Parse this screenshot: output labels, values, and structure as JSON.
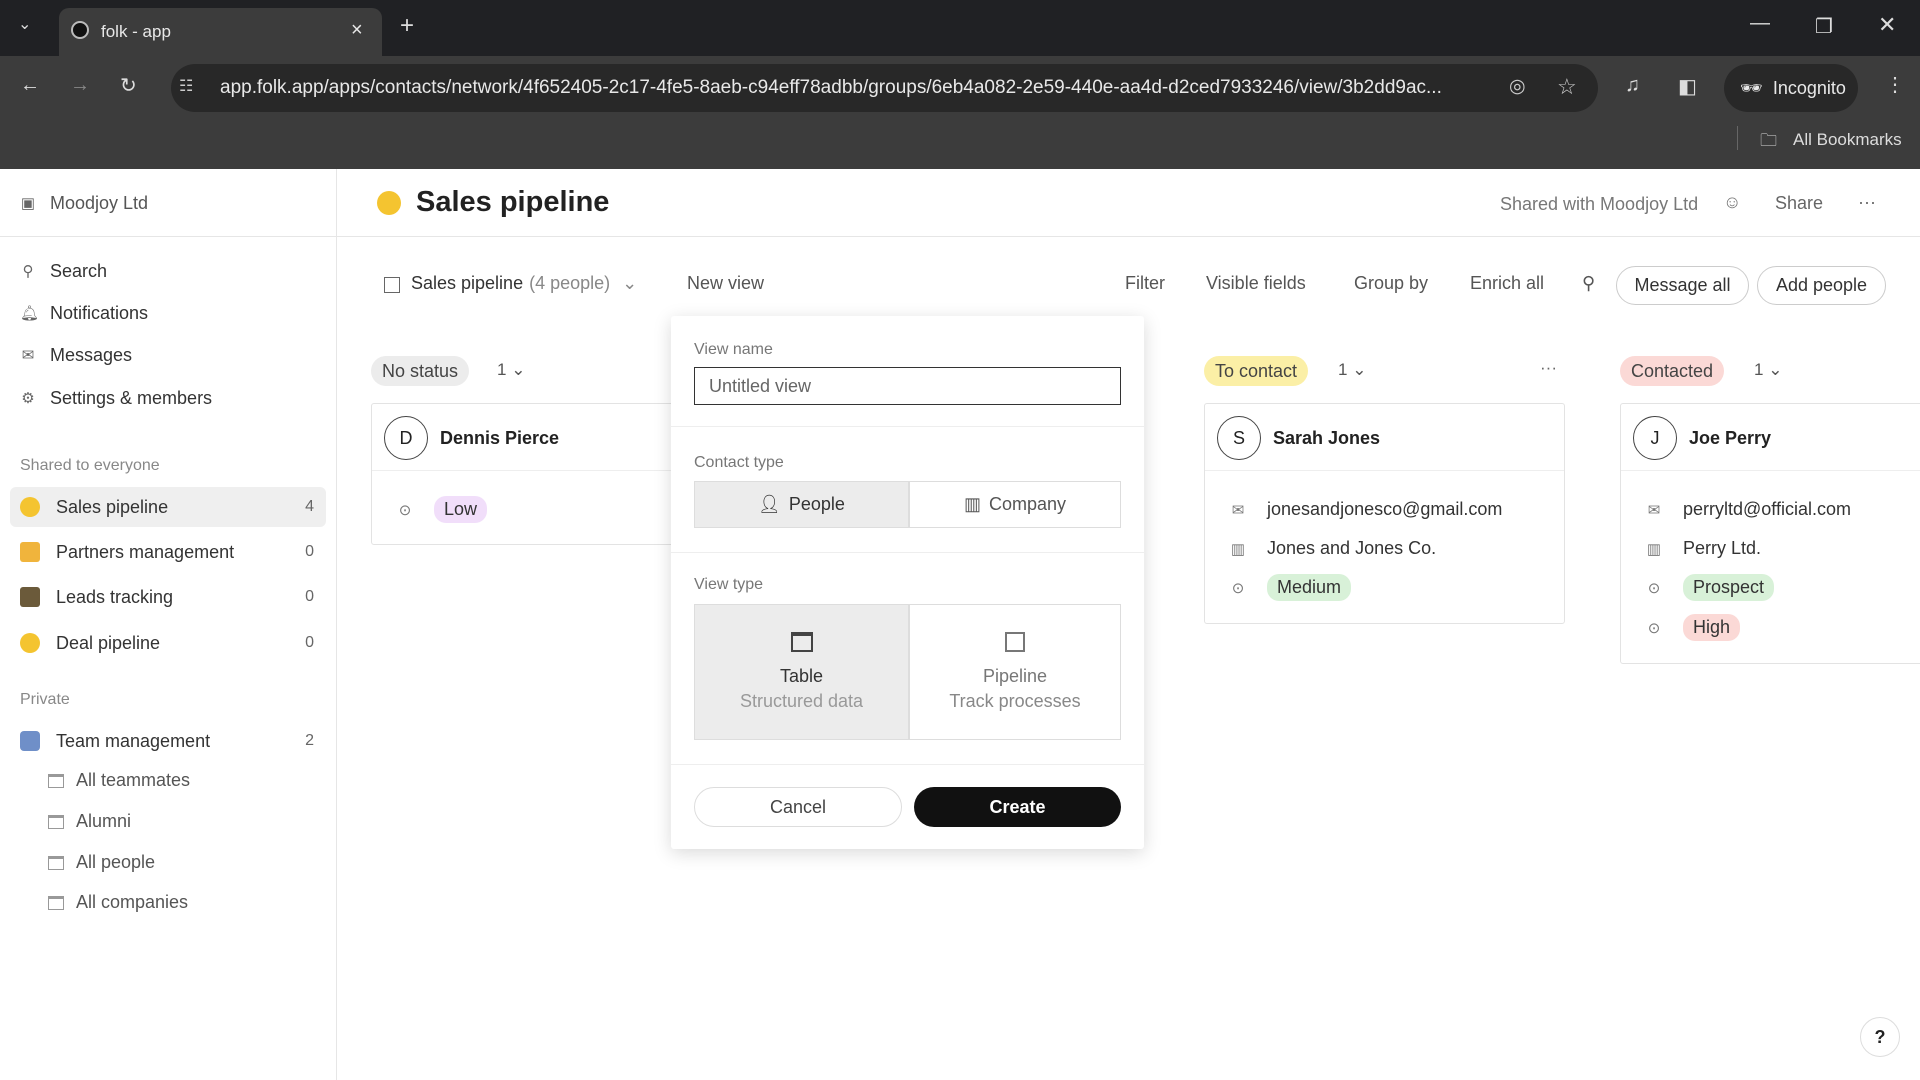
{
  "browser": {
    "tab_title": "folk - app",
    "url": "app.folk.app/apps/contacts/network/4f652405-2c17-4fe5-8aeb-c94eff78adbb/groups/6eb4a082-2e59-440e-aa4d-d2ced7933246/view/3b2dd9ac...",
    "incognito": "Incognito",
    "bookmarks": "All Bookmarks"
  },
  "sidebar": {
    "workspace": "Moodjoy Ltd",
    "nav": [
      {
        "label": "Search",
        "icon": "search-icon"
      },
      {
        "label": "Notifications",
        "icon": "bell-icon"
      },
      {
        "label": "Messages",
        "icon": "mail-icon"
      },
      {
        "label": "Settings & members",
        "icon": "gear-icon"
      }
    ],
    "shared_title": "Shared to everyone",
    "shared": [
      {
        "label": "Sales pipeline",
        "count": "4"
      },
      {
        "label": "Partners management",
        "count": "0"
      },
      {
        "label": "Leads tracking",
        "count": "0"
      },
      {
        "label": "Deal pipeline",
        "count": "0"
      }
    ],
    "private_title": "Private",
    "private": [
      {
        "label": "Team management",
        "count": "2"
      }
    ],
    "views": [
      "All teammates",
      "Alumni",
      "All people",
      "All companies"
    ]
  },
  "header": {
    "title": "Sales pipeline",
    "shared_with": "Shared with Moodjoy Ltd",
    "share": "Share",
    "more": "···"
  },
  "toolbar": {
    "view": "Sales pipeline",
    "view_count": "(4 people)",
    "new_view": "New view",
    "filter": "Filter",
    "visible_fields": "Visible fields",
    "group_by": "Group by",
    "enrich_all": "Enrich all",
    "message_all": "Message all",
    "add_people": "Add people"
  },
  "columns": [
    {
      "status": "No status",
      "count": "1",
      "color": "#ececec",
      "cards": [
        {
          "initial": "D",
          "name": "Dennis Pierce",
          "priority": "Low"
        }
      ]
    },
    {
      "status": "To contact",
      "count": "1",
      "color": "#fbefa6",
      "cards": [
        {
          "initial": "S",
          "name": "Sarah Jones",
          "email": "jonesandjonesco@gmail.com",
          "company": "Jones and Jones Co.",
          "priority": "Medium"
        }
      ]
    },
    {
      "status": "Contacted",
      "count": "1",
      "color": "#fbd9d6",
      "cards": [
        {
          "initial": "J",
          "name": "Joe Perry",
          "email": "perryltd@official.com",
          "company": "Perry Ltd.",
          "stage": "Prospect",
          "priority": "High"
        }
      ]
    }
  ],
  "modal": {
    "view_name_label": "View name",
    "view_name_value": "Untitled view",
    "contact_type_label": "Contact type",
    "contact_types": [
      "People",
      "Company"
    ],
    "view_type_label": "View type",
    "view_types": [
      {
        "title": "Table",
        "desc": "Structured data"
      },
      {
        "title": "Pipeline",
        "desc": "Track processes"
      }
    ],
    "cancel": "Cancel",
    "create": "Create"
  },
  "help": "?"
}
